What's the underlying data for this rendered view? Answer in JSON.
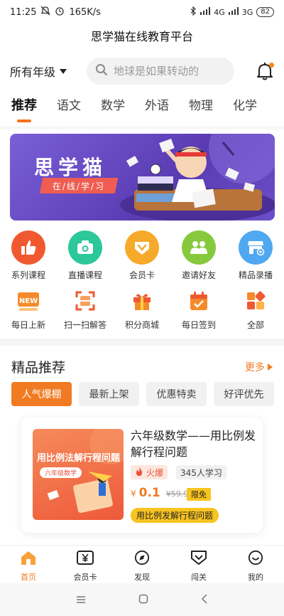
{
  "status_bar": {
    "time": "11:25",
    "speed": "165K/s",
    "net1": "4G",
    "net2": "3G",
    "battery": "82"
  },
  "app_title": "思学猫在线教育平台",
  "header": {
    "grade_select": "所有年级",
    "search_placeholder": "地球是如果转动的"
  },
  "tabs": [
    {
      "label": "推荐",
      "active": true
    },
    {
      "label": "语文"
    },
    {
      "label": "数学"
    },
    {
      "label": "外语"
    },
    {
      "label": "物理"
    },
    {
      "label": "化学"
    }
  ],
  "banner": {
    "title": "思学猫",
    "subtitle": "在/线/学/习"
  },
  "quick_icons_row1": [
    {
      "label": "系列课程",
      "icon": "thumbs-up-icon",
      "color": "#f0592f"
    },
    {
      "label": "直播课程",
      "icon": "camera-icon",
      "color": "#2cc79a"
    },
    {
      "label": "会员卡",
      "icon": "vip-heart-icon",
      "color": "#f7a92a"
    },
    {
      "label": "邀请好友",
      "icon": "friends-icon",
      "color": "#86c93d"
    },
    {
      "label": "精品录播",
      "icon": "shop-icon",
      "color": "#4fa8f0"
    }
  ],
  "quick_icons_row2": [
    {
      "label": "每日上新",
      "icon": "new-badge-icon"
    },
    {
      "label": "扫一扫解答",
      "icon": "scan-icon"
    },
    {
      "label": "积分商城",
      "icon": "gift-icon"
    },
    {
      "label": "每日签到",
      "icon": "calendar-check-icon"
    },
    {
      "label": "全部",
      "icon": "grid-icon"
    }
  ],
  "featured": {
    "title": "精品推荐",
    "more": "更多",
    "filters": [
      "人气爆棚",
      "最新上架",
      "优惠特卖",
      "好评优先"
    ],
    "course": {
      "cover_title": "用比例法解行程问题",
      "cover_pill": "六年级数学",
      "title": "六年级数学——用比例发解行程问题",
      "hot": "火爆",
      "learners": "345人学习",
      "currency": "¥",
      "price": "0.1",
      "old_price": "¥59.9",
      "free_tag": "限免",
      "topic": "用比例发解行程问题"
    }
  },
  "bottom_nav": [
    {
      "label": "首页",
      "icon": "home-icon",
      "active": true
    },
    {
      "label": "会员卡",
      "icon": "yen-card-icon"
    },
    {
      "label": "发现",
      "icon": "compass-icon"
    },
    {
      "label": "闯关",
      "icon": "badge-heart-icon"
    },
    {
      "label": "我的",
      "icon": "smile-icon"
    }
  ],
  "colors": {
    "accent": "#f17b22",
    "banner": "#6a4fc8",
    "tag_yellow": "#f8c41f"
  }
}
